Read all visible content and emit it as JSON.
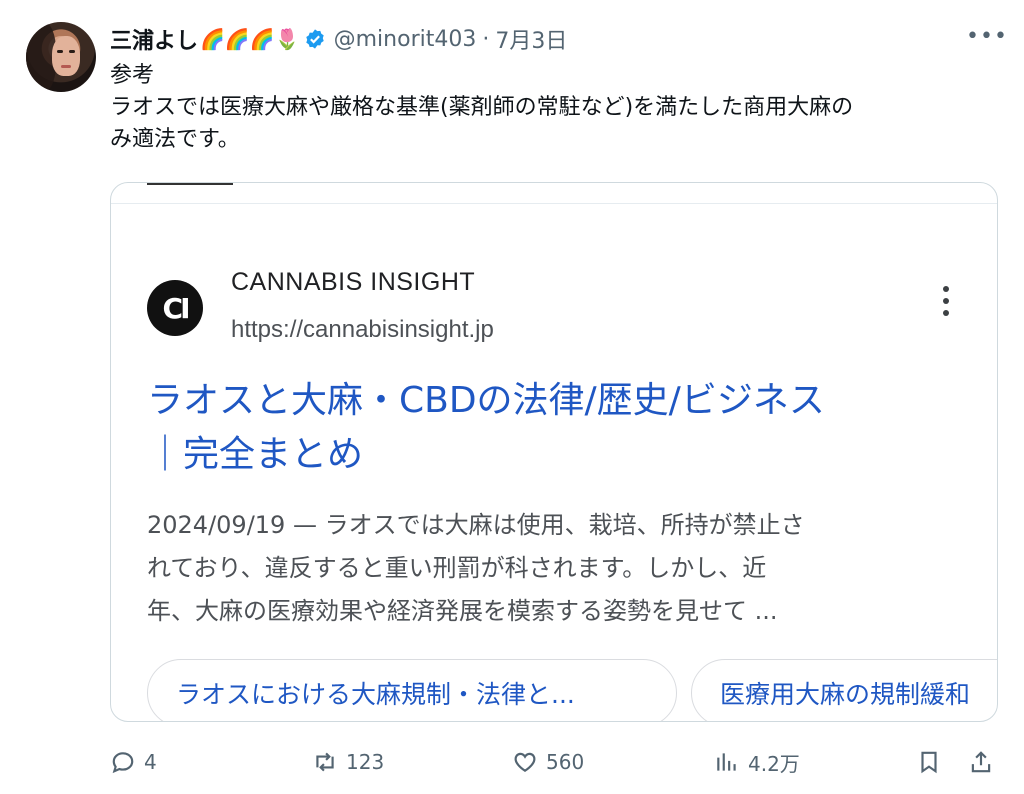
{
  "author": {
    "name": "三浦よし",
    "emoji": "🌈🌈🌈🌷",
    "handle": "@minorit403",
    "dot": "·",
    "date": "7月3日"
  },
  "tweet": {
    "lines": [
      "参考",
      "ラオスでは医療大麻や厳格な基準(薬剤師の常駐など)を満たした商用大麻の",
      "み適法です。"
    ]
  },
  "card": {
    "logo_text": "CI",
    "site_name": "CANNABIS INSIGHT",
    "site_url": "https://cannabisinsight.jp",
    "title_lines": [
      "ラオスと大麻・CBDの法律/歴史/ビジネス",
      "｜完全まとめ"
    ],
    "snippet_lines": [
      "2024/09/19 — ラオスでは大麻は使用、栽培、所持が禁止さ",
      "れており、違反すると重い刑罰が科されます。しかし、近",
      "年、大麻の医療効果や経済発展を模索する姿勢を見せて ..."
    ],
    "chips": [
      "ラオスにおける大麻規制・法律と...",
      "医療用大麻の規制緩和"
    ]
  },
  "actions": {
    "replies": "4",
    "retweets": "123",
    "likes": "560",
    "views": "4.2万"
  },
  "colors": {
    "link": "#1f57c3",
    "muted": "#536471",
    "verified": "#1d9bf0"
  }
}
